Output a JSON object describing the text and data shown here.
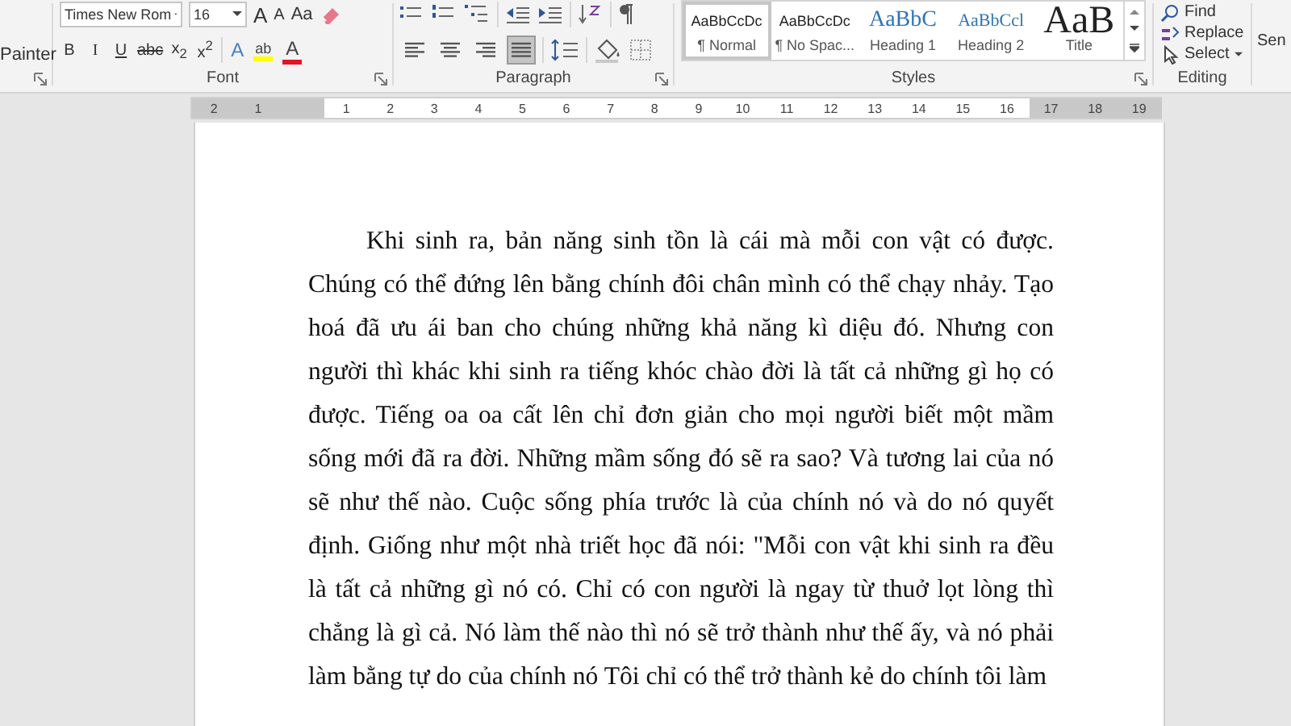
{
  "clipboard": {
    "button": "Painter"
  },
  "font": {
    "name": "Times New Rom",
    "size": "16",
    "label": "Font",
    "grow": "A",
    "shrink": "A",
    "case": "Aa",
    "format_buttons": [
      {
        "kind": "bold",
        "text": "B"
      },
      {
        "kind": "italic",
        "text": "I"
      },
      {
        "kind": "underline",
        "text": "U"
      },
      {
        "kind": "strike",
        "text": "abc"
      },
      {
        "kind": "sub",
        "text": "x$_{2}$"
      },
      {
        "kind": "sup",
        "text": "x$^{2}$"
      }
    ],
    "color_buttons": [
      {
        "kind": "effects",
        "text": "A",
        "color": "#4a7fc1"
      },
      {
        "kind": "highlight",
        "text": "ab",
        "color": "#ffff00"
      },
      {
        "kind": "fontcolor",
        "text": "A",
        "color": "#e81123"
      }
    ]
  },
  "paragraph": {
    "label": "Paragraph",
    "alignments": [
      {
        "kind": "left",
        "selected": false
      },
      {
        "kind": "center",
        "selected": false
      },
      {
        "kind": "right",
        "selected": false
      },
      {
        "kind": "justify",
        "selected": true
      }
    ]
  },
  "styles": {
    "label": "Styles",
    "items": [
      {
        "kind": "normal",
        "preview": "AaBbCcDc",
        "label": "¶ Normal",
        "selected": true
      },
      {
        "kind": "normal",
        "preview": "AaBbCcDc",
        "label": "¶ No Spac...",
        "selected": false
      },
      {
        "kind": "heading1",
        "preview": "AaBbC",
        "label": "Heading 1",
        "selected": false
      },
      {
        "kind": "heading2",
        "preview": "AaBbCcl",
        "label": "Heading 2",
        "selected": false
      },
      {
        "kind": "title",
        "preview": "AaB",
        "label": "Title",
        "selected": false
      }
    ]
  },
  "editing": {
    "label": "Editing",
    "items": [
      {
        "kind": "find",
        "text": "Find"
      },
      {
        "kind": "replace",
        "text": "Replace"
      },
      {
        "kind": "select",
        "text": "Select"
      }
    ]
  },
  "cut_group": "Sen",
  "ruler": [
    {
      "label": "2",
      "margin": true
    },
    {
      "label": "1",
      "margin": true
    },
    {
      "label": "1",
      "margin": false
    },
    {
      "label": "2",
      "margin": false
    },
    {
      "label": "3",
      "margin": false
    },
    {
      "label": "4",
      "margin": false
    },
    {
      "label": "5",
      "margin": false
    },
    {
      "label": "6",
      "margin": false
    },
    {
      "label": "7",
      "margin": false
    },
    {
      "label": "8",
      "margin": false
    },
    {
      "label": "9",
      "margin": false
    },
    {
      "label": "10",
      "margin": false
    },
    {
      "label": "11",
      "margin": false
    },
    {
      "label": "12",
      "margin": false
    },
    {
      "label": "13",
      "margin": false
    },
    {
      "label": "14",
      "margin": false
    },
    {
      "label": "15",
      "margin": false
    },
    {
      "label": "16",
      "margin": false
    },
    {
      "label": "17",
      "margin": true
    },
    {
      "label": "18",
      "margin": true
    },
    {
      "label": "19",
      "margin": true
    }
  ],
  "document": {
    "paragraph": "Khi sinh ra, bản năng sinh tồn là cái mà mỗi con vật có được. Chúng có thể đứng lên bằng chính đôi chân mình có thể chạy nhảy. Tạo hoá đã ưu ái ban cho chúng những khả năng kì diệu đó. Nhưng con người thì khác khi sinh ra tiếng khóc chào đời là tất cả những gì họ có được. Tiếng oa oa cất lên chỉ đơn giản cho mọi người biết một mầm sống mới đã ra đời. Những mầm sống đó sẽ ra sao? Và tương lai của nó sẽ như thế nào. Cuộc sống phía trước là của chính nó và do nó quyết định. Giống như một nhà triết học đã nói: \"Mỗi con vật khi sinh ra đều là tất cả những gì nó có. Chỉ có con người là ngay từ thuở lọt lòng thì chẳng là gì cả. Nó làm thế nào thì nó sẽ trở thành như thế ấy, và nó phải làm bằng tự do của chính nó Tôi chỉ có thể trở thành kẻ do chính tôi làm"
  }
}
